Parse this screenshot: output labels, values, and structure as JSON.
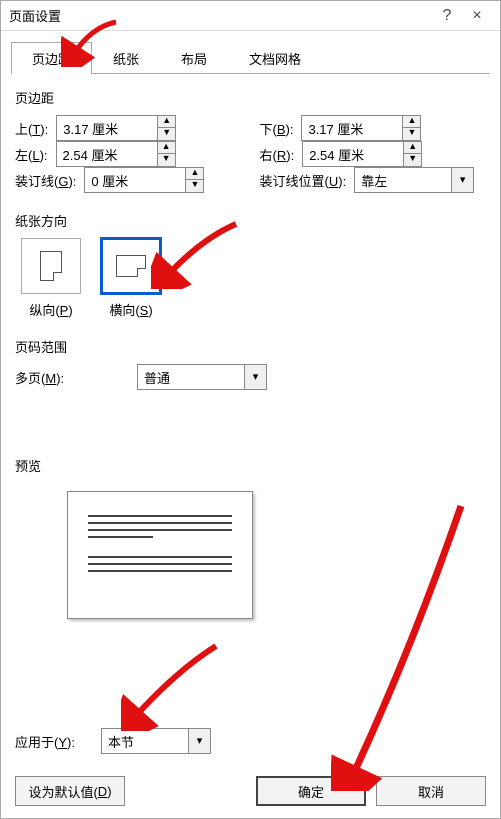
{
  "titlebar": {
    "title": "页面设置",
    "help": "?",
    "close": "×"
  },
  "tabs": {
    "margins": "页边距",
    "paper": "纸张",
    "layout": "布局",
    "grid": "文档网格"
  },
  "margins_section": {
    "heading": "页边距",
    "top_label": "上(T):",
    "bottom_label": "下(B):",
    "left_label": "左(L):",
    "right_label": "右(R):",
    "gutter_label": "装订线(G):",
    "gutter_pos_label": "装订线位置(U):",
    "top_value": "3.17 厘米",
    "bottom_value": "3.17 厘米",
    "left_value": "2.54 厘米",
    "right_value": "2.54 厘米",
    "gutter_value": "0 厘米",
    "gutter_pos_value": "靠左"
  },
  "orientation": {
    "heading": "纸张方向",
    "portrait": "纵向(P)",
    "landscape": "横向(S)"
  },
  "pages": {
    "heading": "页码范围",
    "multi_label": "多页(M):",
    "multi_value": "普通"
  },
  "preview": {
    "heading": "预览"
  },
  "apply": {
    "label": "应用于(Y):",
    "value": "本节"
  },
  "footer": {
    "defaults": "设为默认值(D)",
    "ok": "确定",
    "cancel": "取消"
  }
}
